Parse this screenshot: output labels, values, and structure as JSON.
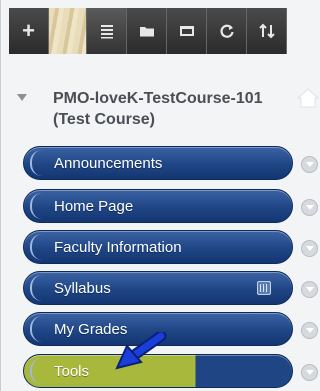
{
  "toolbar": {
    "buttons": [
      {
        "name": "add-icon",
        "symbol": "+"
      },
      {
        "name": "pattern-swatch",
        "symbol": ""
      },
      {
        "name": "list-view-icon",
        "symbol": ""
      },
      {
        "name": "folder-icon",
        "symbol": ""
      },
      {
        "name": "window-icon",
        "symbol": ""
      },
      {
        "name": "refresh-icon",
        "symbol": "C"
      },
      {
        "name": "sort-icon",
        "symbol": "↑↓"
      }
    ]
  },
  "course": {
    "title": "PMO-loveK-TestCourse-101 (Test Course)"
  },
  "menu": {
    "items": [
      {
        "label": "Announcements"
      },
      {
        "label": "Home Page"
      },
      {
        "label": "Faculty Information"
      },
      {
        "label": "Syllabus"
      },
      {
        "label": "My Grades"
      },
      {
        "label": "Tools"
      }
    ]
  },
  "colors": {
    "menu_blue": "#1f4585",
    "tools_highlight": "#a8b83c",
    "arrow": "#1a3fd8"
  }
}
